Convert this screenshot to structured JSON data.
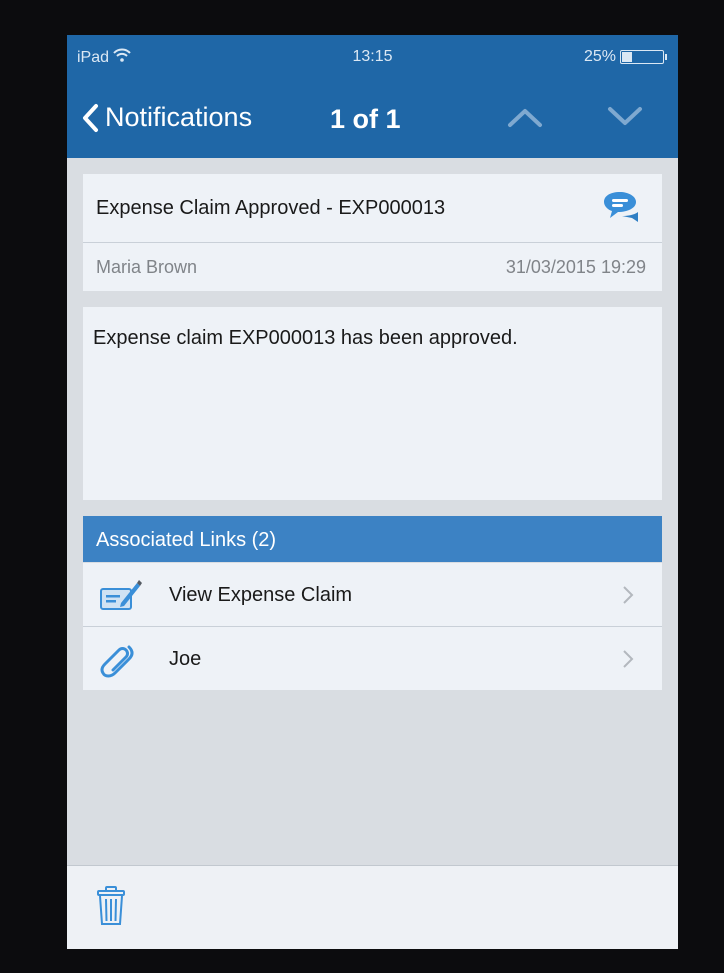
{
  "status_bar": {
    "device": "iPad",
    "time": "13:15",
    "battery_percent": "25%",
    "battery_level": 0.25
  },
  "nav": {
    "back_label": "Notifications",
    "position": "1 of 1"
  },
  "notification": {
    "title": "Expense Claim Approved - EXP000013",
    "sender": "Maria Brown",
    "timestamp": "31/03/2015 19:29",
    "body": "Expense claim EXP000013 has been approved."
  },
  "links": {
    "header": "Associated Links (2)",
    "items": [
      {
        "label": "View Expense Claim",
        "icon": "expense-form-icon"
      },
      {
        "label": "Joe",
        "icon": "paperclip-icon"
      }
    ]
  },
  "colors": {
    "nav_bar": "#1f67a7",
    "section_header": "#3c82c4",
    "icon_blue": "#3a8fd8"
  }
}
